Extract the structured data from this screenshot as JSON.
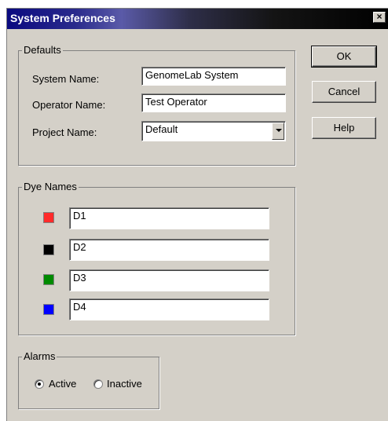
{
  "window": {
    "title": "System Preferences",
    "close_glyph": "×"
  },
  "defaults": {
    "legend": "Defaults",
    "system_name_label": "System Name:",
    "system_name_value": "GenomeLab System",
    "operator_name_label": "Operator Name:",
    "operator_name_value": "Test Operator",
    "project_name_label": "Project Name:",
    "project_name_value": "Default"
  },
  "buttons": {
    "ok": "OK",
    "cancel": "Cancel",
    "help": "Help"
  },
  "dye_names": {
    "legend": "Dye Names",
    "items": [
      {
        "value": "D1",
        "color": "#ff2a2a"
      },
      {
        "value": "D2",
        "color": "#000000"
      },
      {
        "value": "D3",
        "color": "#008a00"
      },
      {
        "value": "D4",
        "color": "#0000ff"
      }
    ]
  },
  "alarms": {
    "legend": "Alarms",
    "active_label": "Active",
    "inactive_label": "Inactive",
    "selected": "Active"
  }
}
